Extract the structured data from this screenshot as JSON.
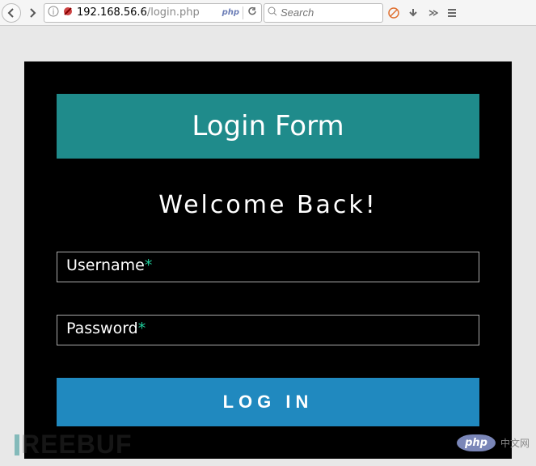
{
  "browser": {
    "url_host": "192.168.56.6",
    "url_path": "/login.php",
    "url_badge": "php",
    "search_placeholder": "Search"
  },
  "login": {
    "header": "Login Form",
    "welcome": "Welcome Back!",
    "username_label": "Username",
    "password_label": "Password",
    "required_mark": "*",
    "submit_label": "LOG IN"
  },
  "watermark": {
    "left": "REEBUF",
    "right_logo": "php",
    "right_text": "中文网"
  }
}
